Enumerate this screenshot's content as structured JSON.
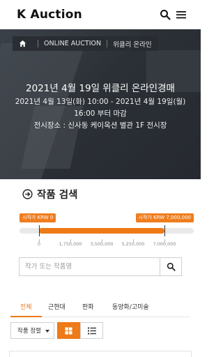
{
  "header": {
    "logo": "K Auction",
    "search_icon": "search-icon",
    "menu_icon": "hamburger-menu-icon"
  },
  "hero": {
    "breadcrumb": {
      "home_icon": "home-icon",
      "items": [
        "ONLINE AUCTION",
        "위클리 온라인"
      ]
    },
    "title": "2021년 4월 19일 위클리 온라인경매",
    "period": "2021년 4월 13일(화) 10:00 - 2021년 4월 19일(월)",
    "deadline": "16:00 부터 마감",
    "venue": "전시장소 : 신사동 케이옥션 별관 1F 전시장"
  },
  "search_section": {
    "title": "작품 검색",
    "title_icon": "arrow-circle-right-icon",
    "price_range": {
      "min_label": "시작가 KRW 0",
      "max_label": "시작가 KRW 7,000,000",
      "min_value": 0,
      "max_value": 7000000,
      "selected_min": 0,
      "selected_max": 7000000,
      "ticks": [
        "0",
        "1,750,000",
        "3,500,000",
        "5,250,000",
        "7,000,000"
      ]
    },
    "search_input": {
      "placeholder": "작가 또는 작품명",
      "value": ""
    }
  },
  "tabs": {
    "items": [
      "전체",
      "근현대",
      "판화",
      "동양화/고미술"
    ],
    "active_index": 0
  },
  "toolbar": {
    "sort_label": "작품 정렬",
    "grid_view_icon": "grid-view-icon",
    "list_view_icon": "list-view-icon",
    "active_view": "grid"
  },
  "colors": {
    "accent": "#ee7a18",
    "hero_bg": "#2b3036"
  }
}
